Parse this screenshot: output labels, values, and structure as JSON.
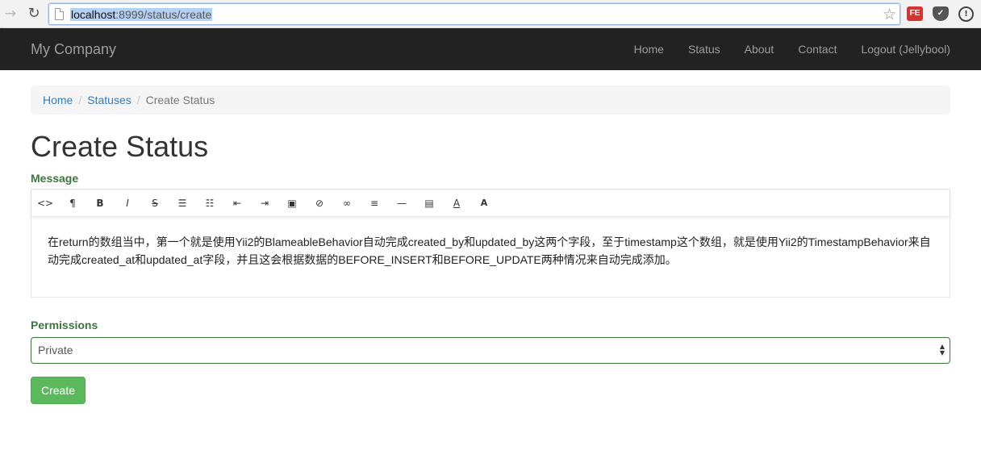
{
  "browser": {
    "url_host": "localhost",
    "url_rest": ":8999/status/create",
    "back_icon": "arrow-left-icon",
    "reload_icon": "reload-icon",
    "extensions": {
      "fe_label": "FE",
      "pocket_icon": "pocket-icon",
      "info_label": "!"
    }
  },
  "navbar": {
    "brand": "My Company",
    "links": [
      "Home",
      "Status",
      "About",
      "Contact",
      "Logout (Jellybool)"
    ]
  },
  "breadcrumb": {
    "items": [
      "Home",
      "Statuses"
    ],
    "active": "Create Status",
    "separator": "/"
  },
  "page": {
    "title": "Create Status"
  },
  "form": {
    "message_label": "Message",
    "toolbar": [
      {
        "icon": "code-icon",
        "glyph": "<>"
      },
      {
        "icon": "paragraph-icon",
        "glyph": "¶"
      },
      {
        "icon": "bold-icon",
        "glyph": "B"
      },
      {
        "icon": "italic-icon",
        "glyph": "I"
      },
      {
        "icon": "strikethrough-icon",
        "glyph": "S"
      },
      {
        "icon": "unordered-list-icon",
        "glyph": "☰"
      },
      {
        "icon": "ordered-list-icon",
        "glyph": "☷"
      },
      {
        "icon": "outdent-icon",
        "glyph": "⇤"
      },
      {
        "icon": "indent-icon",
        "glyph": "⇥"
      },
      {
        "icon": "image-icon",
        "glyph": "▣"
      },
      {
        "icon": "file-icon",
        "glyph": "⊘"
      },
      {
        "icon": "link-icon",
        "glyph": "∞"
      },
      {
        "icon": "align-icon",
        "glyph": "≡"
      },
      {
        "icon": "horizontal-rule-icon",
        "glyph": "—"
      },
      {
        "icon": "table-icon",
        "glyph": "▤"
      },
      {
        "icon": "font-color-icon",
        "glyph": "A"
      },
      {
        "icon": "background-color-icon",
        "glyph": "A"
      }
    ],
    "message_text": "在return的数组当中，第一个就是使用Yii2的BlameableBehavior自动完成created_by和updated_by这两个字段，至于timestamp这个数组，就是使用Yii2的TimestampBehavior来自动完成created_at和updated_at字段，并且这会根据数据的BEFORE_INSERT和BEFORE_UPDATE两种情况来自动完成添加。",
    "permissions_label": "Permissions",
    "permissions_value": "Private",
    "submit_label": "Create"
  },
  "colors": {
    "navbar_bg": "#222222",
    "success_green": "#5cb85c",
    "label_green": "#3c763d",
    "link_blue": "#337ab7"
  }
}
